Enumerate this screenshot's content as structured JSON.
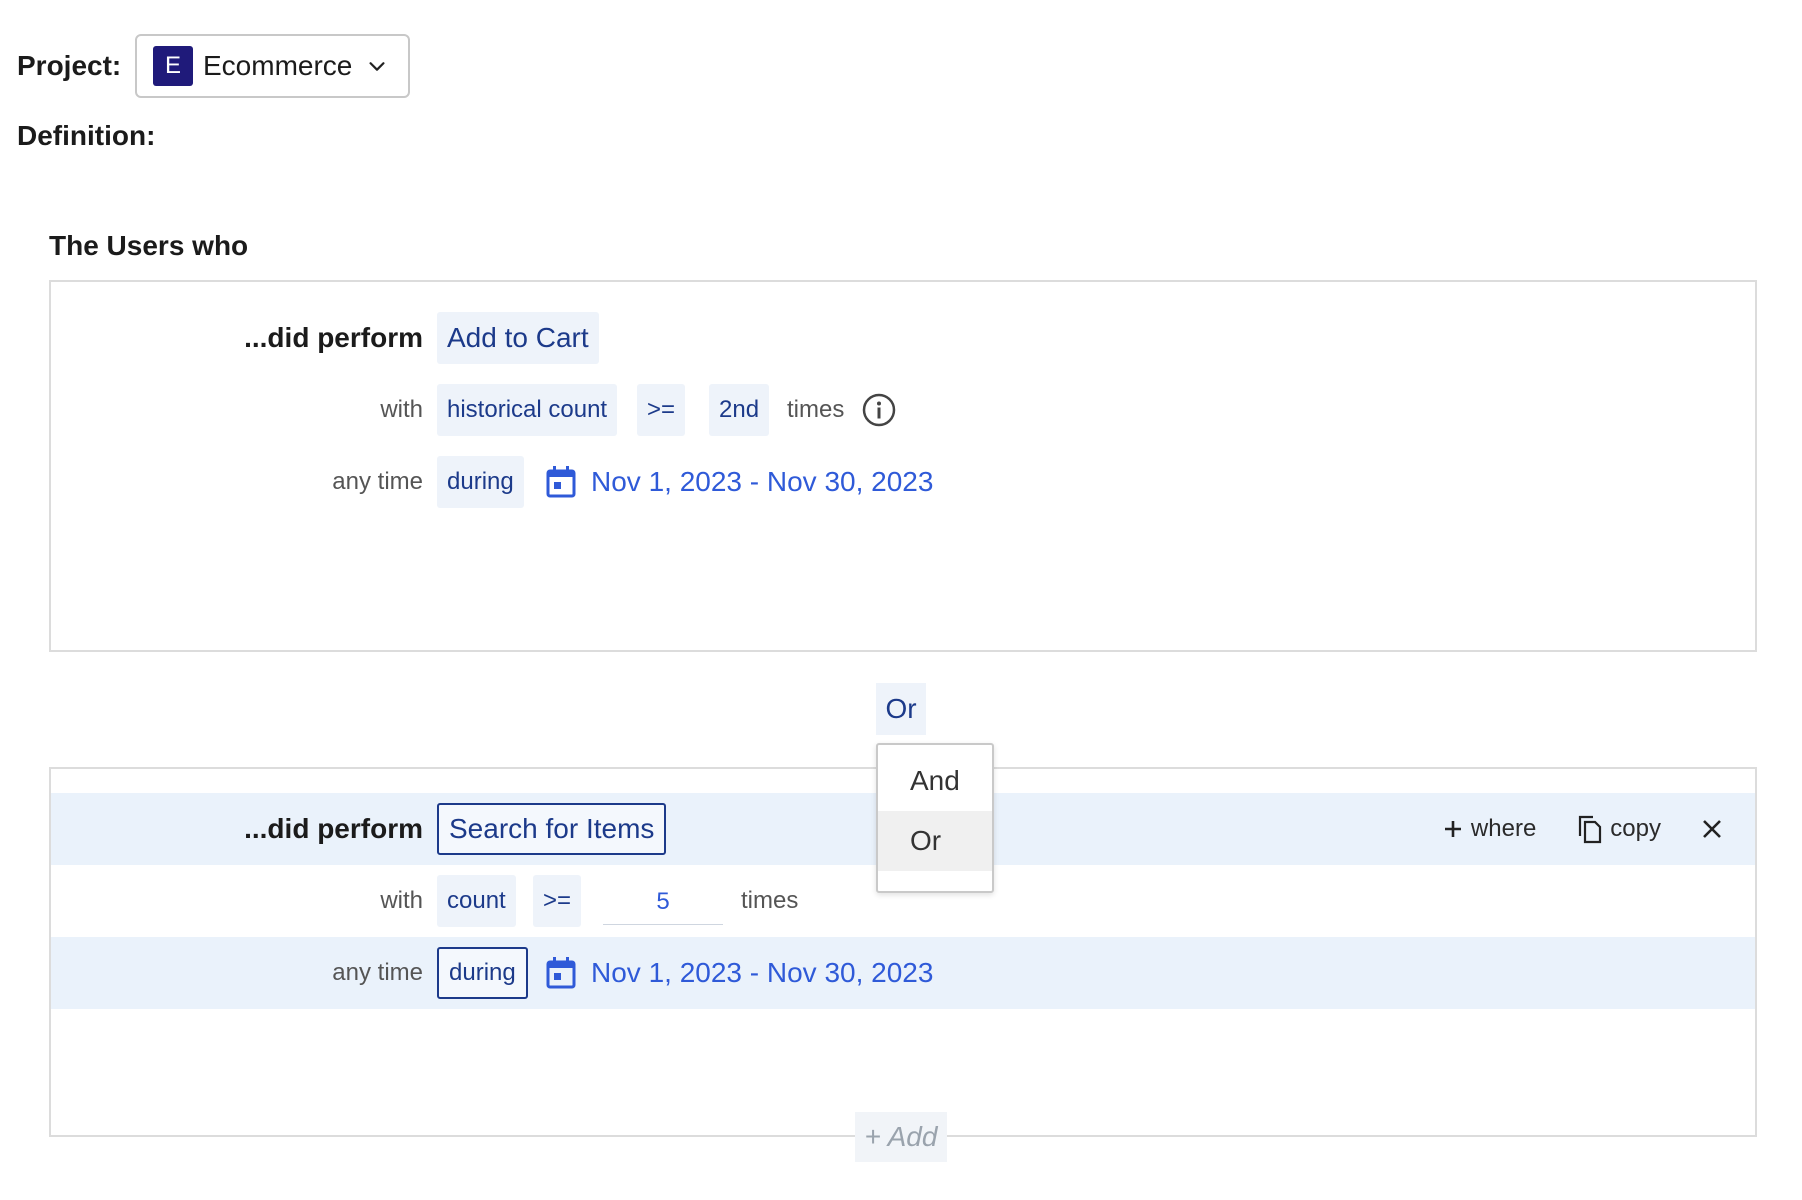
{
  "project": {
    "label": "Project:",
    "avatar_letter": "E",
    "name": "Ecommerce",
    "avatar_color": "#1f1a7a"
  },
  "definition_label": "Definition:",
  "users_who_label": "The Users who",
  "condition1": {
    "perform_label": "...did perform",
    "event": "Add to Cart",
    "with_label": "with",
    "metric": "historical count",
    "operator": ">=",
    "value": "2nd",
    "times_label": "times",
    "time_label": "any time",
    "time_op": "during",
    "date_range": "Nov 1, 2023 - Nov 30, 2023"
  },
  "logic_operator": "Or",
  "dropdown": {
    "options": [
      "And",
      "Or"
    ],
    "selected": "Or"
  },
  "condition2": {
    "perform_label": "...did perform",
    "event": "Search for Items",
    "with_label": "with",
    "metric": "count",
    "operator": ">=",
    "value": "5",
    "times_label": "times",
    "time_label": "any time",
    "time_op": "during",
    "date_range": "Nov 1, 2023 - Nov 30, 2023",
    "actions": {
      "where_label": "where",
      "copy_label": "copy"
    }
  },
  "add_label": "+ Add",
  "colors": {
    "accent_blue": "#2f5ad8",
    "chip_text": "#1c3a8a",
    "chip_bg": "#eef3fa",
    "row_highlight": "#eaf2fb"
  }
}
